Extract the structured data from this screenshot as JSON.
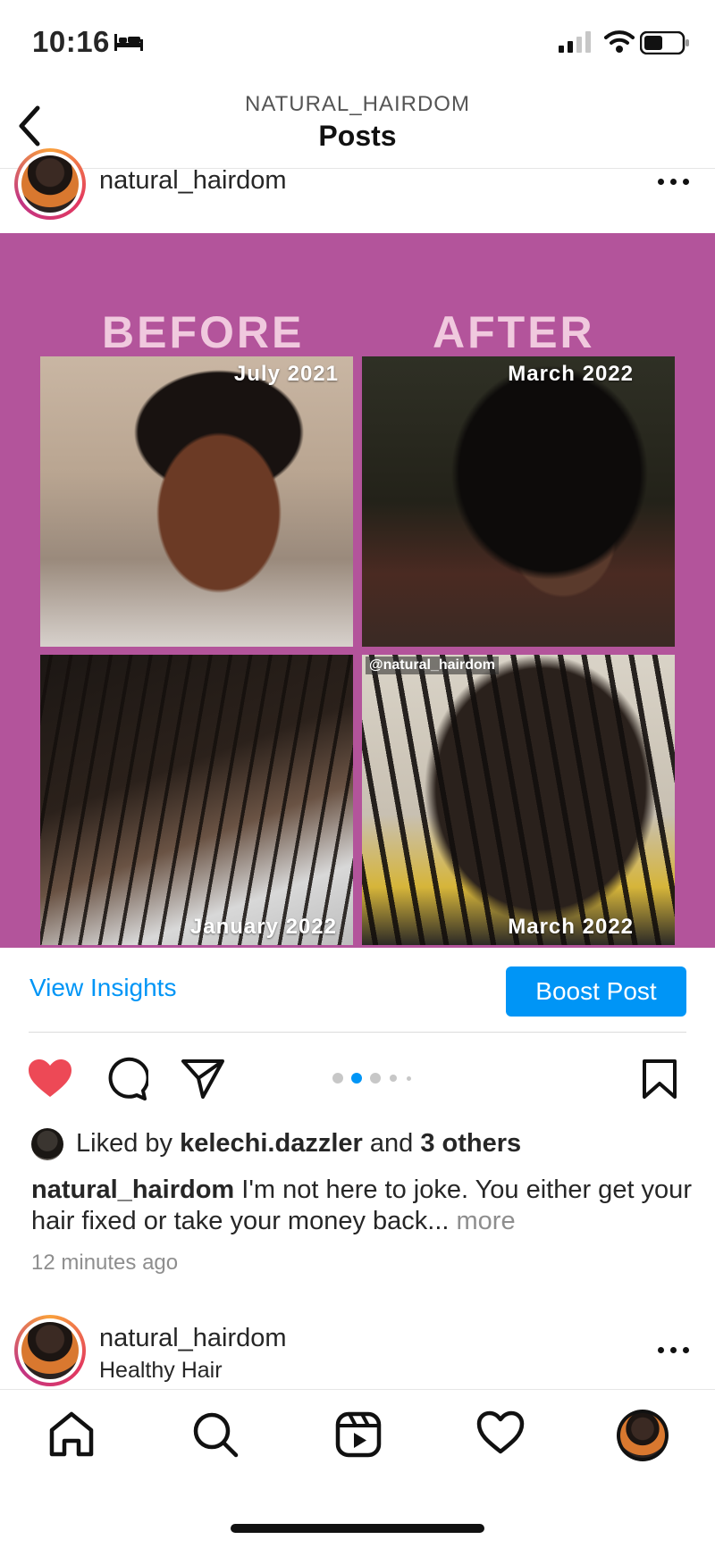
{
  "status_bar": {
    "time": "10:16",
    "icons": [
      "bed-icon",
      "signal-icon",
      "wifi-icon",
      "battery-icon"
    ]
  },
  "header": {
    "subtitle": "NATURAL_HAIRDOM",
    "title": "Posts",
    "back_icon": "chevron-left-icon"
  },
  "post": {
    "username": "natural_hairdom",
    "image": {
      "before_label": "BEFORE",
      "after_label": "AFTER",
      "dates": [
        "July 2021",
        "March 2022",
        "January 2022",
        "March 2022"
      ],
      "watermark": "@natural_hairdom",
      "background_color": "#b3549b"
    },
    "view_insights_label": "View Insights",
    "boost_label": "Boost Post",
    "carousel": {
      "count": 5,
      "active_index": 1
    },
    "likes": {
      "prefix": "Liked by",
      "user": "kelechi.dazzler",
      "connector": "and",
      "others": "3 others"
    },
    "caption": {
      "user": "natural_hairdom",
      "text": "I'm not here to joke. You either get your hair fixed or take your money back...",
      "more": "more"
    },
    "timestamp": "12 minutes ago",
    "liked": true
  },
  "next_post": {
    "username": "natural_hairdom",
    "subtitle": "Healthy Hair"
  },
  "bottom_nav": {
    "items": [
      "home-icon",
      "search-icon",
      "reels-icon",
      "activity-heart-icon",
      "profile-avatar"
    ]
  },
  "colors": {
    "accent": "#0095f6",
    "like_red": "#ed4956",
    "post_background": "#b3549b"
  }
}
